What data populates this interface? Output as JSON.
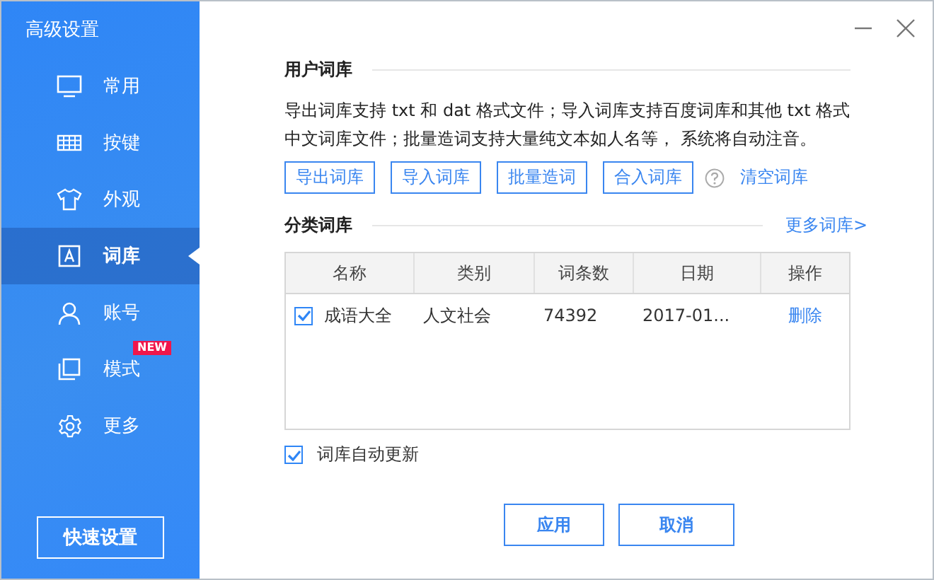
{
  "window": {
    "title": "高级设置"
  },
  "sidebar": {
    "items": [
      {
        "label": "常用",
        "kind": "monitor",
        "selected": false
      },
      {
        "label": "按键",
        "kind": "keyboard",
        "selected": false
      },
      {
        "label": "外观",
        "kind": "shirt",
        "selected": false
      },
      {
        "label": "词库",
        "kind": "letter",
        "selected": true
      },
      {
        "label": "账号",
        "kind": "person",
        "selected": false
      },
      {
        "label": "模式",
        "kind": "pages",
        "selected": false,
        "badge": "NEW"
      },
      {
        "label": "更多",
        "kind": "gear",
        "selected": false
      }
    ],
    "quick_button": "快速设置"
  },
  "user_dict": {
    "title": "用户词库",
    "description": "导出词库支持 txt 和 dat 格式文件；导入词库支持百度词库和其他 txt 格式中文词库文件；批量造词支持大量纯文本如人名等， 系统将自动注音。",
    "buttons": [
      "导出词库",
      "导入词库",
      "批量造词",
      "合入词库"
    ],
    "clear_link": "清空词库"
  },
  "category_dict": {
    "title": "分类词库",
    "more_link": "更多词库>",
    "table": {
      "columns": [
        "名称",
        "类别",
        "词条数",
        "日期",
        "操作"
      ],
      "rows": [
        {
          "checked": true,
          "cells": [
            "成语大全",
            "人文社会",
            "74392",
            "2017-01..."
          ],
          "action": "删除"
        }
      ]
    }
  },
  "auto_update": {
    "label": "词库自动更新",
    "checked": true
  },
  "buttons": [
    "应用",
    "取消"
  ]
}
